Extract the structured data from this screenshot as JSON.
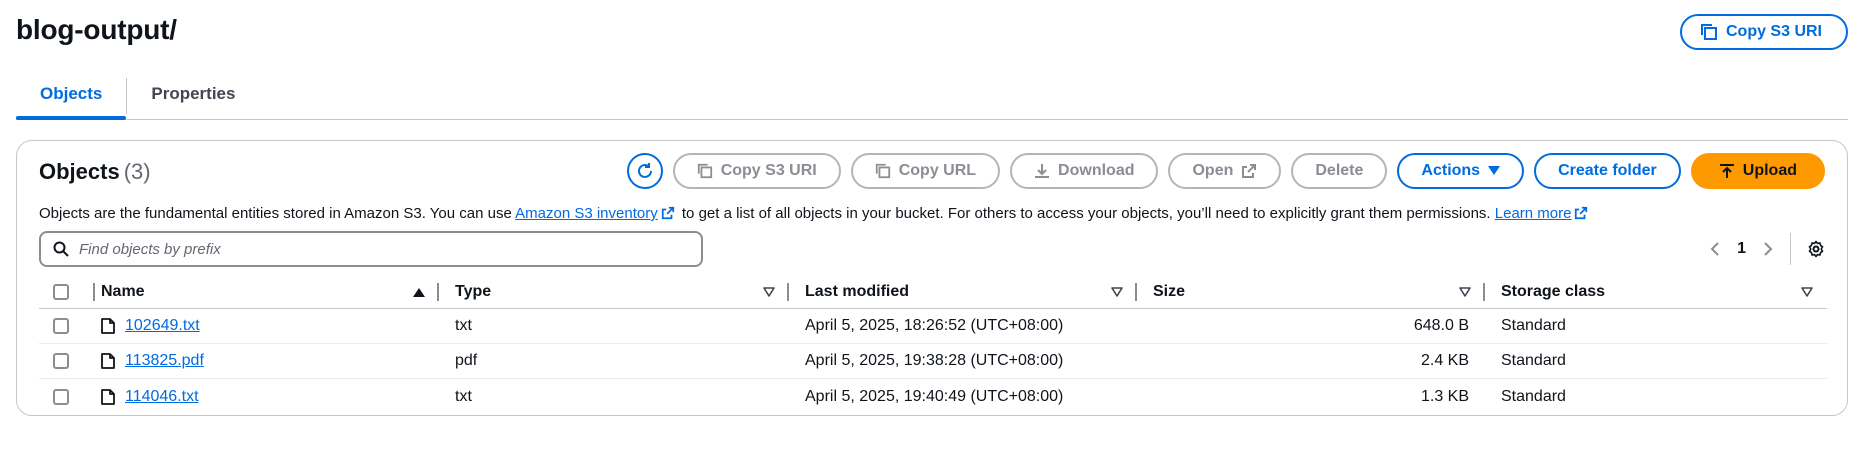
{
  "page": {
    "title": "blog-output/",
    "copy_uri_label": "Copy S3 URI"
  },
  "tabs": [
    {
      "label": "Objects",
      "active": true
    },
    {
      "label": "Properties",
      "active": false
    }
  ],
  "objects_panel": {
    "title": "Objects",
    "count": "(3)",
    "buttons": {
      "copy_s3_uri": "Copy S3 URI",
      "copy_url": "Copy URL",
      "download": "Download",
      "open": "Open",
      "delete": "Delete",
      "actions": "Actions",
      "create_folder": "Create folder",
      "upload": "Upload"
    },
    "description": {
      "part1": "Objects are the fundamental entities stored in Amazon S3. You can use ",
      "link1": "Amazon S3 inventory",
      "part2": " to get a list of all objects in your bucket. For others to access your objects, you’ll need to explicitly grant them permissions. ",
      "link2": "Learn more"
    },
    "search": {
      "placeholder": "Find objects by prefix",
      "value": ""
    },
    "pagination": {
      "current_page": "1"
    }
  },
  "table": {
    "columns": {
      "name": "Name",
      "type": "Type",
      "last_modified": "Last modified",
      "size": "Size",
      "storage_class": "Storage class"
    },
    "rows": [
      {
        "name": "102649.txt",
        "type": "txt",
        "last_modified": "April 5, 2025, 18:26:52 (UTC+08:00)",
        "size": "648.0 B",
        "storage_class": "Standard"
      },
      {
        "name": "113825.pdf",
        "type": "pdf",
        "last_modified": "April 5, 2025, 19:38:28 (UTC+08:00)",
        "size": "2.4 KB",
        "storage_class": "Standard"
      },
      {
        "name": "114046.txt",
        "type": "txt",
        "last_modified": "April 5, 2025, 19:40:49 (UTC+08:00)",
        "size": "1.3 KB",
        "storage_class": "Standard"
      }
    ]
  },
  "colors": {
    "accent": "#006ce0",
    "upload": "#ff9900",
    "disabled": "#8c8c94",
    "border": "#c6c6cd"
  },
  "icons": [
    "copy-icon",
    "refresh-icon",
    "download-icon",
    "external-link-icon",
    "caret-down-icon",
    "upload-icon",
    "search-icon",
    "chevron-left-icon",
    "chevron-right-icon",
    "settings-icon",
    "sort-ascending-icon",
    "sort-descending-icon",
    "file-icon"
  ]
}
